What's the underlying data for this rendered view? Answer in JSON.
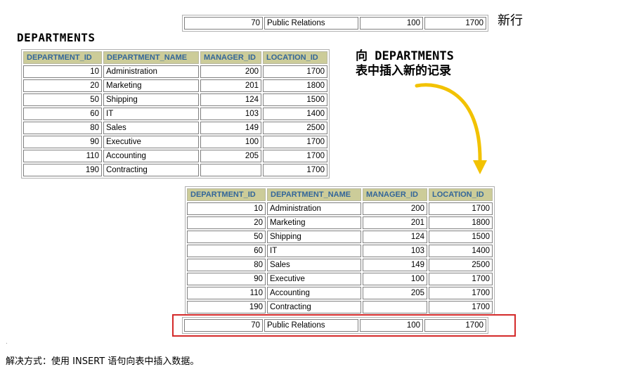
{
  "new_row_label": "新行",
  "table_title": "DEPARTMENTS",
  "callout": {
    "line1": "向 DEPARTMENTS",
    "line2": "表中插入新的记录"
  },
  "columns": [
    "DEPARTMENT_ID",
    "DEPARTMENT_NAME",
    "MANAGER_ID",
    "LOCATION_ID"
  ],
  "rows": [
    {
      "id": "10",
      "name": "Administration",
      "manager": "200",
      "location": "1700"
    },
    {
      "id": "20",
      "name": "Marketing",
      "manager": "201",
      "location": "1800"
    },
    {
      "id": "50",
      "name": "Shipping",
      "manager": "124",
      "location": "1500"
    },
    {
      "id": "60",
      "name": "IT",
      "manager": "103",
      "location": "1400"
    },
    {
      "id": "80",
      "name": "Sales",
      "manager": "149",
      "location": "2500"
    },
    {
      "id": "90",
      "name": "Executive",
      "manager": "100",
      "location": "1700"
    },
    {
      "id": "110",
      "name": "Accounting",
      "manager": "205",
      "location": "1700"
    },
    {
      "id": "190",
      "name": "Contracting",
      "manager": "",
      "location": "1700"
    }
  ],
  "new_row": {
    "id": "70",
    "name": "Public Relations",
    "manager": "100",
    "location": "1700"
  },
  "footer_note": "解决方式：使用 INSERT 语句向表中插入数据。",
  "colors": {
    "header_bg": "#cccc99",
    "header_text": "#336699",
    "highlight_border": "#d42a2a",
    "arrow": "#f2c200"
  }
}
